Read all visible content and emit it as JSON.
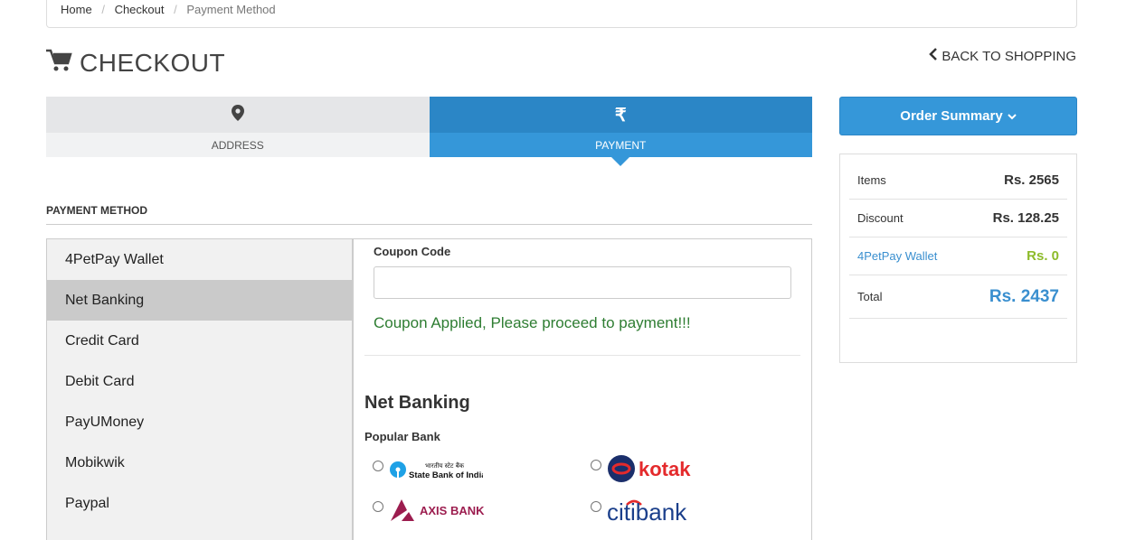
{
  "breadcrumb": {
    "home": "Home",
    "checkout": "Checkout",
    "current": "Payment Method"
  },
  "page": {
    "title": "CHECKOUT",
    "back_link": "BACK TO SHOPPING"
  },
  "steps": {
    "address": "ADDRESS",
    "payment": "PAYMENT",
    "payment_symbol": "₹"
  },
  "payment_method": {
    "heading": "PAYMENT METHOD",
    "methods": [
      "4PetPay Wallet",
      "Net Banking",
      "Credit Card",
      "Debit Card",
      "PayUMoney",
      "Mobikwik",
      "Paypal"
    ],
    "selected": "Net Banking"
  },
  "coupon": {
    "label": "Coupon Code",
    "value": "",
    "message": "Coupon Applied, Please proceed to payment!!!"
  },
  "net_banking": {
    "title": "Net Banking",
    "popular_label": "Popular Bank",
    "banks": [
      {
        "name": "State Bank of India",
        "hindi": "भारतीय स्टेट बैंक"
      },
      {
        "name": "kotak"
      },
      {
        "name": "AXIS BANK"
      },
      {
        "name": "citibank"
      }
    ]
  },
  "order_summary": {
    "button": "Order Summary",
    "items_label": "Items",
    "items_value": "Rs. 2565",
    "discount_label": "Discount",
    "discount_value": "Rs. 128.25",
    "wallet_label": "4PetPay Wallet",
    "wallet_value": "Rs. 0",
    "total_label": "Total",
    "total_value": "Rs. 2437"
  },
  "colors": {
    "primary": "#3597d9",
    "primary_dark": "#2b86c6",
    "success": "#2e7d32",
    "wallet_value": "#8dbb2a"
  }
}
